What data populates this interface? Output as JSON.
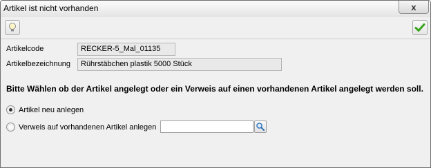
{
  "window": {
    "title": "Artikel ist nicht vorhanden",
    "close_symbol": "x"
  },
  "toolbar": {
    "left_icon": "lightbulb-icon",
    "right_icon": "green-checkmark-icon"
  },
  "form": {
    "code_label": "Artikelcode",
    "code_value": "RECKER-5_Mal_01135",
    "desc_label": "Artikelbezeichnung",
    "desc_value": "Rührstäbchen plastik 5000 Stück",
    "question": "Bitte Wählen ob der Artikel angelegt oder ein Verweis auf einen vorhandenen Artikel angelegt werden soll.",
    "option_new": "Artikel neu anlegen",
    "option_ref": "Verweis auf vorhandenen Artikel anlegen",
    "ref_input_value": "",
    "selected_option": "new"
  },
  "colors": {
    "checkmark": "#3aa41c",
    "window_bg": "#f0f0f0"
  }
}
